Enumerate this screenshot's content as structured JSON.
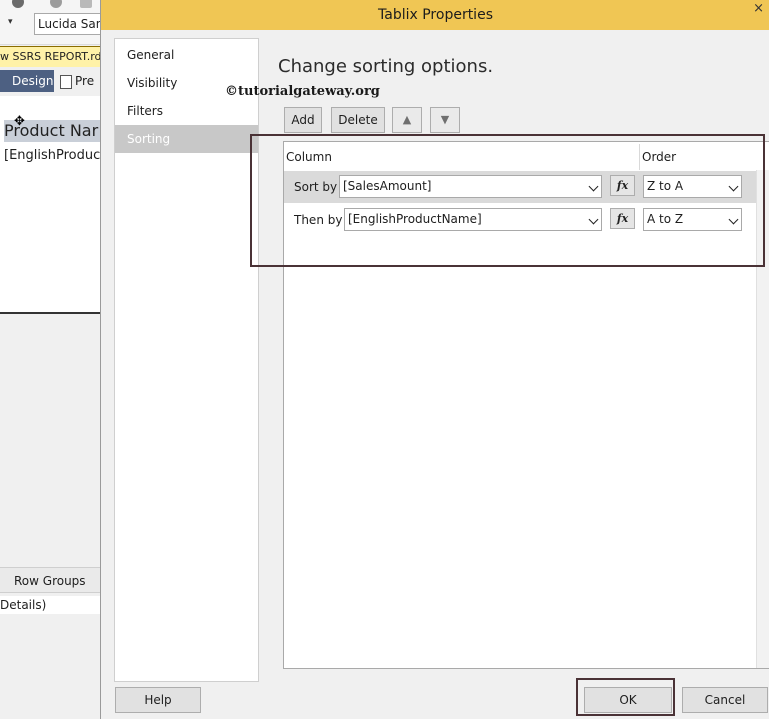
{
  "background_ide": {
    "font_combo": "Lucida Sans",
    "document_tab": "w SSRS REPORT.rdl",
    "design_tab": "Design",
    "preview_tab": "Pre",
    "header_cell": "Product Nar",
    "detail_cell": "[EnglishProduc",
    "row_groups": "Row Groups",
    "details": "Details)"
  },
  "dialog": {
    "title": "Tablix Properties",
    "close_glyph": "×",
    "nav": [
      {
        "label": "General"
      },
      {
        "label": "Visibility"
      },
      {
        "label": "Filters"
      },
      {
        "label": "Sorting"
      }
    ],
    "heading": "Change sorting options.",
    "watermark": "©tutorialgateway.org",
    "toolbar": {
      "add": "Add",
      "delete": "Delete",
      "move_up_icon": "▲",
      "move_down_icon": "▼"
    },
    "grid": {
      "column_header": "Column",
      "order_header": "Order",
      "rows": [
        {
          "label": "Sort by",
          "column": "[SalesAmount]",
          "fx": "fx",
          "order": "Z to A"
        },
        {
          "label": "Then by",
          "column": "[EnglishProductName]",
          "fx": "fx",
          "order": "A to Z"
        }
      ]
    },
    "buttons": {
      "help": "Help",
      "ok": "OK",
      "cancel": "Cancel"
    }
  },
  "colors": {
    "titlebar": "#f0c654",
    "selected_nav": "#c8c8c8",
    "highlight_border": "#4a3236",
    "design_tab": "#4d6082"
  }
}
